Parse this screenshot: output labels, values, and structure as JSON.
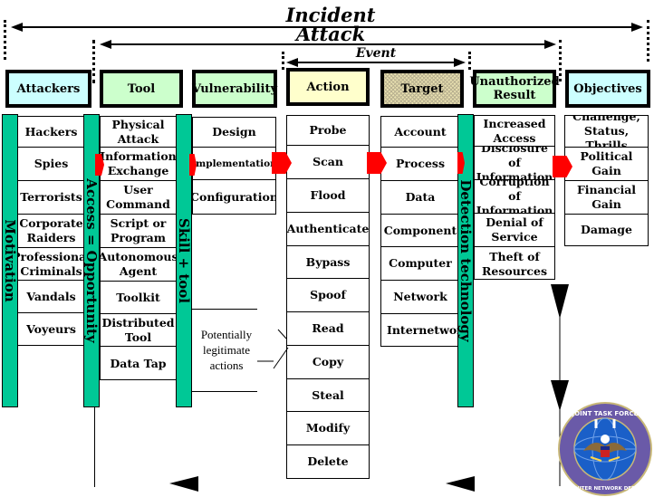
{
  "spans": {
    "incident": "Incident",
    "attack": "Attack",
    "event": "Event"
  },
  "headers": [
    {
      "label": "Attackers",
      "color": "#ccffff"
    },
    {
      "label": "Tool",
      "color": "#ccffcc"
    },
    {
      "label": "Vulnerability",
      "color": "#ccffcc"
    },
    {
      "label": "Action",
      "color": "#ffffcc"
    },
    {
      "label": "Target",
      "color": "#e8e0b0"
    },
    {
      "label": "Unauthorized Result",
      "color": "#ccffcc"
    },
    {
      "label": "Objectives",
      "color": "#ccffff"
    }
  ],
  "columns": {
    "attackers": [
      "Hackers",
      "Spies",
      "Terrorists",
      "Corporate Raiders",
      "Professional Criminals",
      "Vandals",
      "Voyeurs"
    ],
    "tool": [
      "Physical Attack",
      "Information Exchange",
      "User Command",
      "Script or Program",
      "Autonomous Agent",
      "Toolkit",
      "Distributed Tool",
      "Data Tap"
    ],
    "vulnerability": [
      "Design",
      "Implementation",
      "Configuration"
    ],
    "action": [
      "Probe",
      "Scan",
      "Flood",
      "Authenticate",
      "Bypass",
      "Spoof",
      "Read",
      "Copy",
      "Steal",
      "Modify",
      "Delete"
    ],
    "target": [
      "Account",
      "Process",
      "Data",
      "Component",
      "Computer",
      "Network",
      "Internetwork"
    ],
    "result": [
      "Increased Access",
      "Disclosure of Information",
      "Corruption of Information",
      "Denial of Service",
      "Theft of Resources"
    ],
    "objectives": [
      "Challenge, Status, Thrills",
      "Political Gain",
      "Financial Gain",
      "Damage"
    ]
  },
  "bars": {
    "motivation": "Motivation",
    "access": "Access = Opportunity",
    "skill": "Skill + tool",
    "detection": "Detection technology"
  },
  "note": {
    "line1": "Potentially",
    "line2": "legitimate",
    "line3": "actions"
  },
  "seal": {
    "top_text": "JOINT TASK FORCE",
    "bottom_text": "COMPUTER NETWORK DEFENSE"
  },
  "colors": {
    "bar": "#00c896",
    "arrow": "#ff0000"
  }
}
